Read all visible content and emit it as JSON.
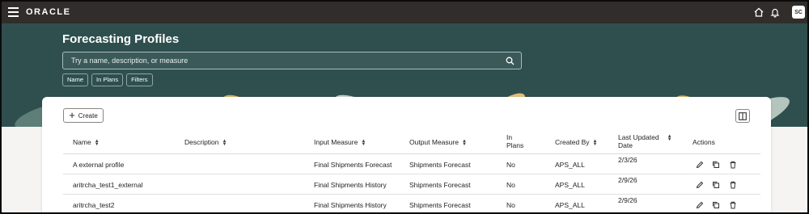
{
  "header": {
    "logo": "ORACLE",
    "avatar_initials": "SC",
    "icons": [
      "menu-icon",
      "home-icon",
      "bell-icon"
    ]
  },
  "hero": {
    "title": "Forecasting Profiles",
    "search_placeholder": "Try a name, description, or measure",
    "chips": [
      "Name",
      "In Plans",
      "Filters"
    ]
  },
  "toolbar": {
    "create_label": "Create"
  },
  "table": {
    "columns": {
      "name": "Name",
      "description": "Description",
      "input_measure": "Input Measure",
      "output_measure": "Output Measure",
      "in_plans_1": "In",
      "in_plans_2": "Plans",
      "created_by": "Created By",
      "last_updated_1": "Last Updated",
      "last_updated_2": "Date",
      "actions": "Actions"
    },
    "rows": [
      {
        "name": "A external profile",
        "description": "",
        "input_measure": "Final Shipments Forecast",
        "output_measure": "Shipments Forecast",
        "in_plans": "No",
        "created_by": "APS_ALL",
        "last_updated": "2/3/26"
      },
      {
        "name": "aritrcha_test1_external",
        "description": "",
        "input_measure": "Final Shipments History",
        "output_measure": "Shipments Forecast",
        "in_plans": "No",
        "created_by": "APS_ALL",
        "last_updated": "2/9/26"
      },
      {
        "name": "aritrcha_test2",
        "description": "",
        "input_measure": "Final Shipments History",
        "output_measure": "Shipments Forecast",
        "in_plans": "No",
        "created_by": "APS_ALL",
        "last_updated": "2/9/26"
      }
    ]
  },
  "colors": {
    "topbar": "#312d2a",
    "hero": "#2f4f4f",
    "card": "#ffffff"
  }
}
